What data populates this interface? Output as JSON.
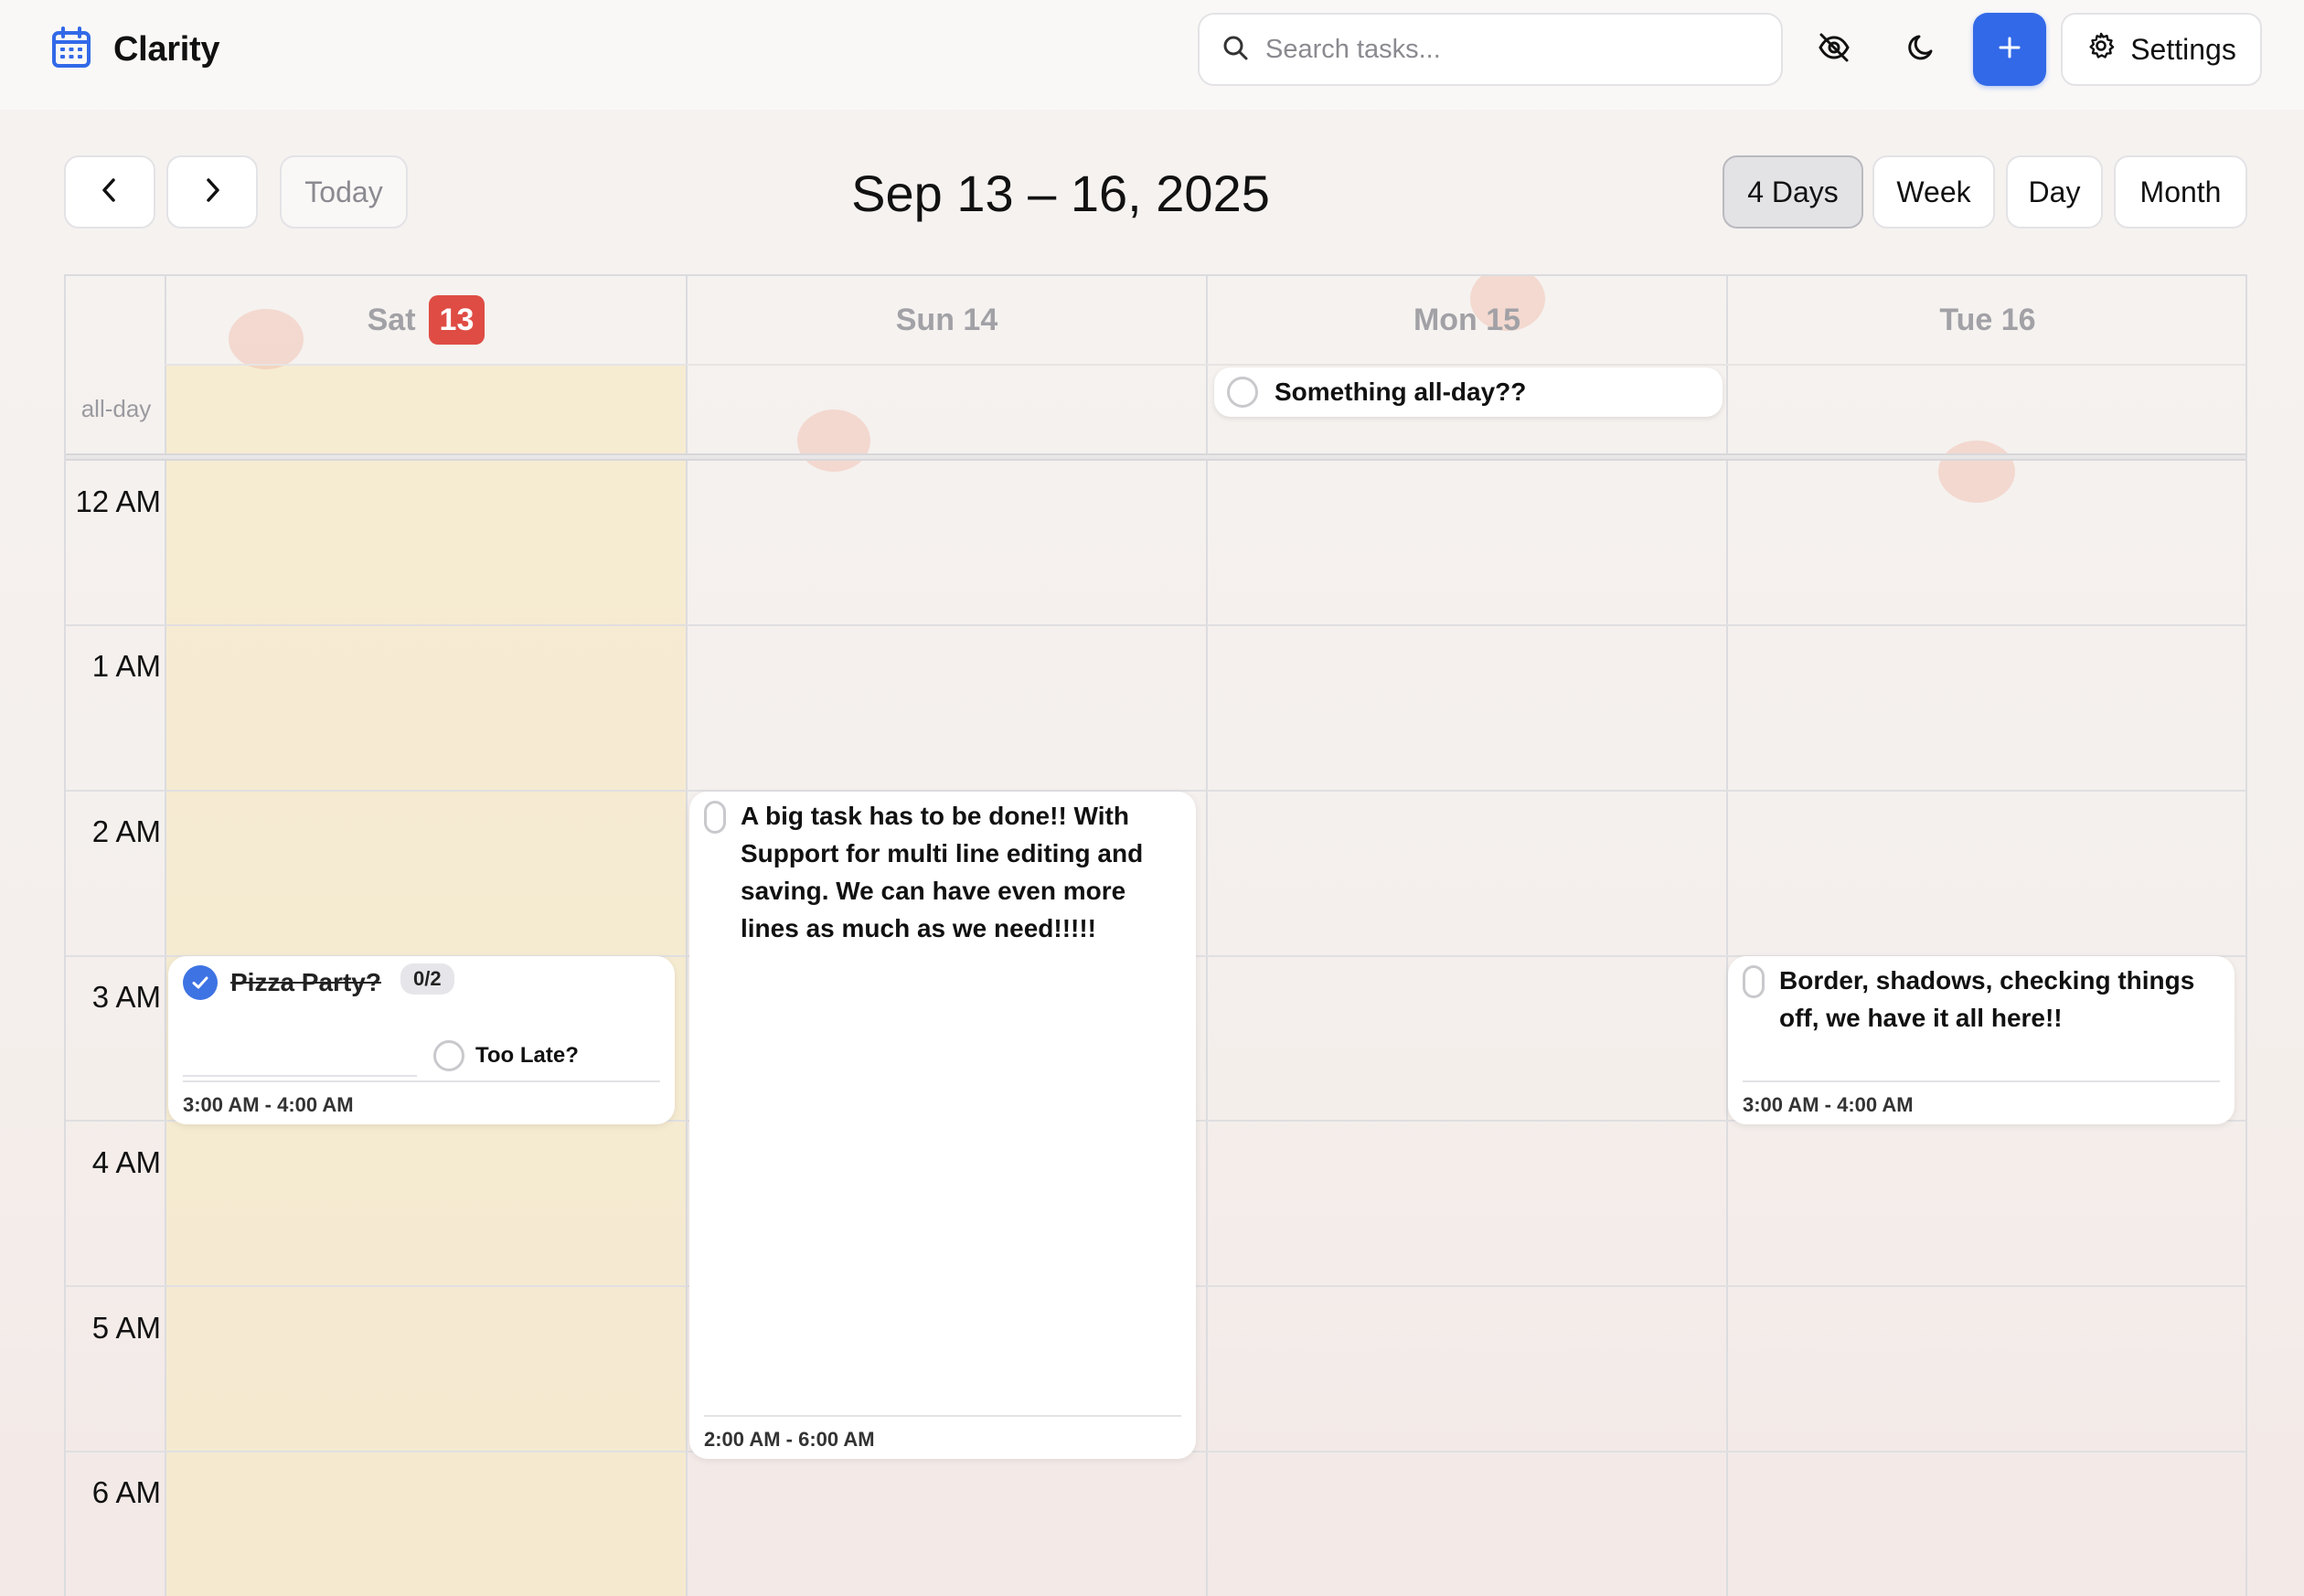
{
  "app": {
    "title": "Clarity"
  },
  "search": {
    "placeholder": "Search tasks..."
  },
  "toolbar": {
    "hide_icon": "eye-off-icon",
    "theme_icon": "moon-icon",
    "add_label": "+",
    "settings_label": "Settings"
  },
  "nav": {
    "today_label": "Today",
    "range_title": "Sep 13 – 16, 2025"
  },
  "views": [
    {
      "label": "4 Days",
      "active": true
    },
    {
      "label": "Week",
      "active": false
    },
    {
      "label": "Day",
      "active": false
    },
    {
      "label": "Month",
      "active": false
    }
  ],
  "calendar": {
    "allday_label": "all-day",
    "days": [
      {
        "name": "Sat",
        "date": "13",
        "today": true
      },
      {
        "name": "Sun",
        "date": "14",
        "label": "Sun 14"
      },
      {
        "name": "Mon",
        "date": "15",
        "label": "Mon 15"
      },
      {
        "name": "Tue",
        "date": "16",
        "label": "Tue 16"
      }
    ],
    "hours": [
      "12 AM",
      "1 AM",
      "2 AM",
      "3 AM",
      "4 AM",
      "5 AM",
      "6 AM"
    ],
    "today_color": "#df4c44",
    "today_column_color": "#f5e9c8"
  },
  "events": {
    "allday": {
      "title": "Something all-day??",
      "day": "Mon 15"
    },
    "pizza": {
      "title": "Pizza Party?",
      "completed": true,
      "subtask_count": "0/2",
      "subtask": "Too Late?",
      "time": "3:00 AM - 4:00 AM",
      "day": "Sat 13"
    },
    "big_task": {
      "title": "A big task has to be done!! With Support for multi line editing and saving. We can have even more lines as much as we need!!!!!",
      "time": "2:00 AM - 6:00 AM",
      "day": "Sun 14"
    },
    "border_task": {
      "title": "Border, shadows, checking things off, we have it all here!!",
      "time": "3:00 AM - 4:00 AM",
      "day": "Tue 16"
    }
  },
  "colors": {
    "accent": "#3269e8",
    "check": "#3e73e4"
  }
}
